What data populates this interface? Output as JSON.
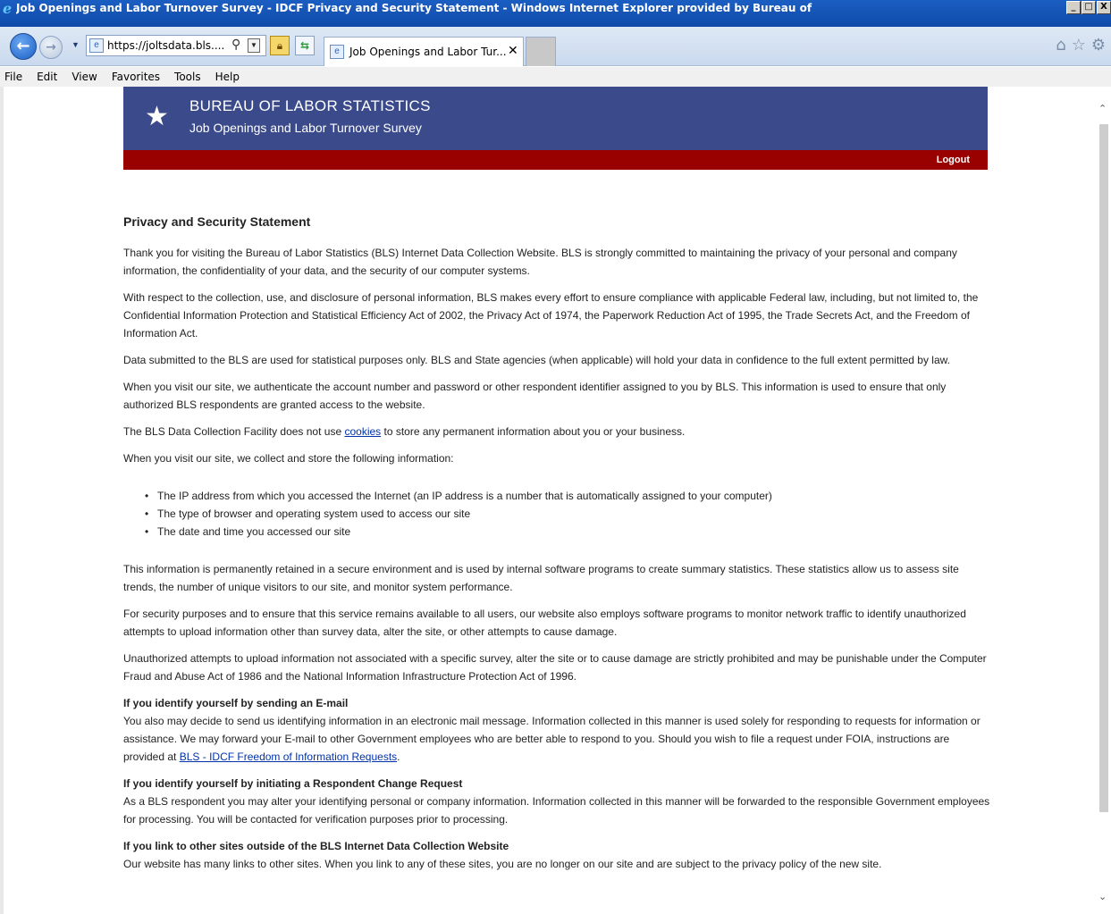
{
  "window": {
    "title": "Job Openings and Labor Turnover Survey - IDCF Privacy and Security Statement - Windows Internet Explorer provided by Bureau of",
    "btn_min": "_",
    "btn_max": "□",
    "btn_close": "X"
  },
  "nav": {
    "url": "https://joltsdata.bls....",
    "tab_label": "Job Openings and Labor Tur...",
    "tab_close": "✕"
  },
  "menu": {
    "file": "File",
    "edit": "Edit",
    "view": "View",
    "favorites": "Favorites",
    "tools": "Tools",
    "help": "Help"
  },
  "bls": {
    "title": "BUREAU OF LABOR STATISTICS",
    "subtitle": "Job Openings and Labor Turnover Survey",
    "logout": "Logout"
  },
  "content": {
    "heading": "Privacy and Security Statement",
    "p1": "Thank you for visiting the Bureau of Labor Statistics (BLS) Internet Data Collection Website. BLS is strongly committed to maintaining the privacy of your personal and company information, the confidentiality of your data, and the security of our computer systems.",
    "p2": "With respect to the collection, use, and disclosure of personal information, BLS makes every effort to ensure compliance with applicable Federal law, including, but not limited to, the Confidential Information Protection and Statistical Efficiency Act of 2002, the Privacy Act of 1974, the Paperwork Reduction Act of 1995, the Trade Secrets Act, and the Freedom of Information Act.",
    "p3": "Data submitted to the BLS are used for statistical purposes only. BLS and State agencies (when applicable) will hold your data in confidence to the full extent permitted by law.",
    "p4": "When you visit our site, we authenticate the account number and password or other respondent identifier assigned to you by BLS. This information is used to ensure that only authorized BLS respondents are granted access to the website.",
    "p5_before": "The BLS Data Collection Facility does not use ",
    "p5_link": "cookies",
    "p5_after": " to store any permanent information about you or your business.",
    "p6": "When you visit our site, we collect and store the following information:",
    "bullets": [
      "The IP address from which you accessed the Internet (an IP address is a number that is automatically assigned to your computer)",
      "The type of browser and operating system used to access our site",
      "The date and time you accessed our site"
    ],
    "p7": "This information is permanently retained in a secure environment and is used by internal software programs to create summary statistics. These statistics allow us to assess site trends, the number of unique visitors to our site, and monitor system performance.",
    "p8": "For security purposes and to ensure that this service remains available to all users, our website also employs software programs to monitor network traffic to identify unauthorized attempts to upload information other than survey data, alter the site, or other attempts to cause damage.",
    "p9": "Unauthorized attempts to upload information not associated with a specific survey, alter the site or to cause damage are strictly prohibited and may be punishable under the Computer Fraud and Abuse Act of 1986 and the National Information Infrastructure Protection Act of 1996.",
    "h_email": "If you identify yourself by sending an E-mail",
    "p_email_before": "You also may decide to send us identifying information in an electronic mail message. Information collected in this manner is used solely for responding to requests for information or assistance. We may forward your E-mail to other Government employees who are better able to respond to you. Should you wish to file a request under FOIA, instructions are provided at ",
    "p_email_link": "BLS - IDCF Freedom of Information Requests",
    "p_email_after": ".",
    "h_change": "If you identify yourself by initiating a Respondent Change Request",
    "p_change": "As a BLS respondent you may alter your identifying personal or company information. Information collected in this manner will be forwarded to the responsible Government employees for processing. You will be contacted for verification purposes prior to processing.",
    "h_links": "If you link to other sites outside of the BLS Internet Data Collection Website",
    "p_links": "Our website has many links to other sites. When you link to any of these sites, you are no longer on our site and are subject to the privacy policy of the new site."
  }
}
